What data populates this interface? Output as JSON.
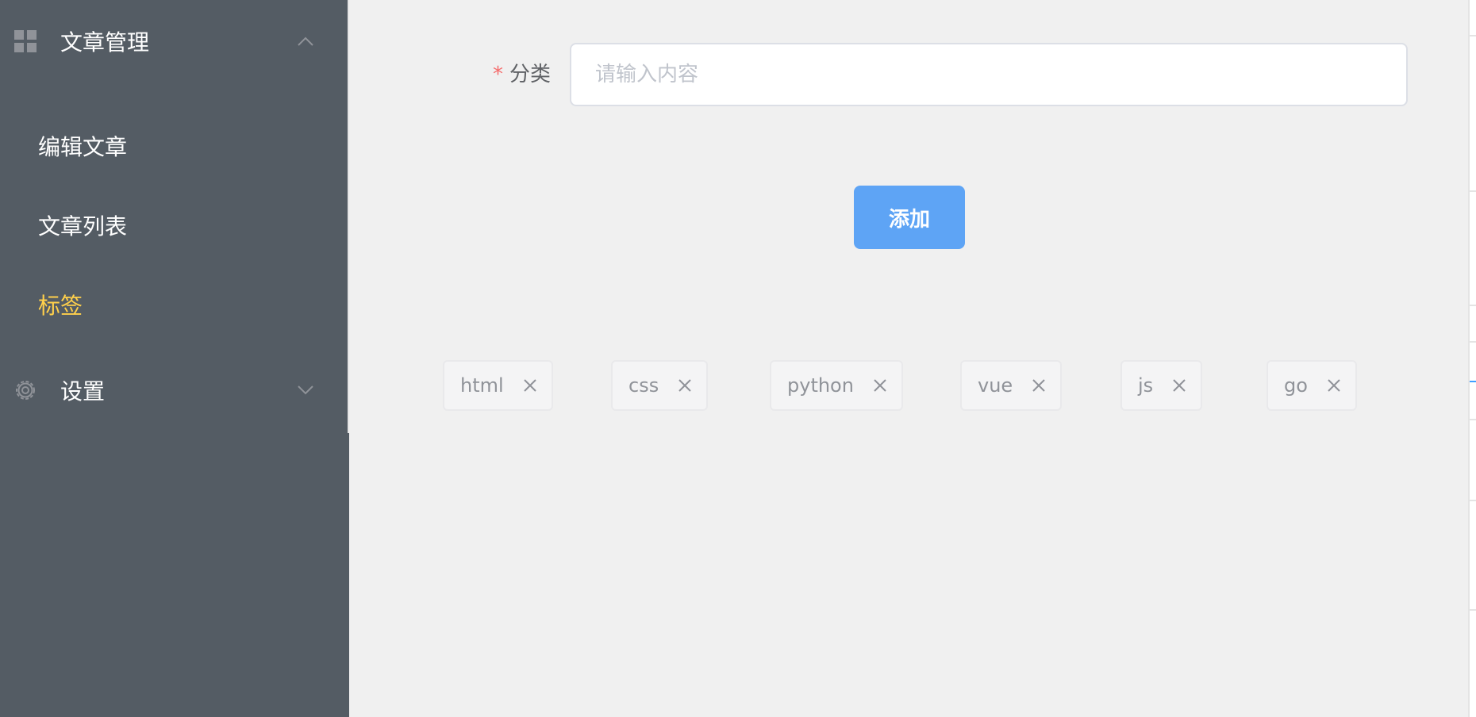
{
  "sidebar": {
    "menus": [
      {
        "title": "文章管理",
        "icon": "grid-icon",
        "expanded": true,
        "items": [
          {
            "label": "编辑文章",
            "active": false
          },
          {
            "label": "文章列表",
            "active": false
          },
          {
            "label": "标签",
            "active": true
          }
        ]
      },
      {
        "title": "设置",
        "icon": "gear-icon",
        "expanded": false
      }
    ],
    "background_color": "#545c64",
    "active_text_color": "#ffd04b"
  },
  "form": {
    "required_mark": "*",
    "label": "分类",
    "input_value": "",
    "input_placeholder": "请输入内容"
  },
  "add_button": {
    "label": "添加",
    "color": "#5ea4f5"
  },
  "tags": [
    {
      "label": "html"
    },
    {
      "label": "css"
    },
    {
      "label": "python"
    },
    {
      "label": "vue"
    },
    {
      "label": "js"
    },
    {
      "label": "go"
    }
  ]
}
